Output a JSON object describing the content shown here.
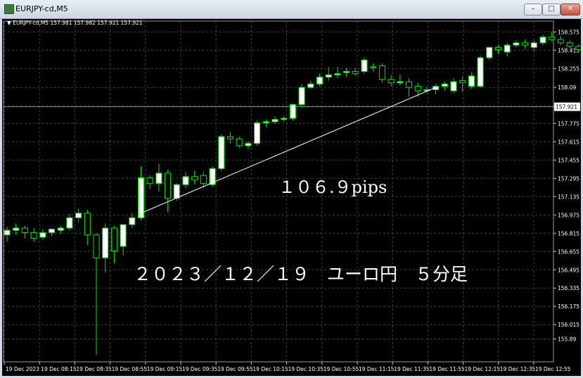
{
  "window": {
    "title": "EURJPY-cd,M5",
    "minimize_glyph": "–",
    "maximize_glyph": "□",
    "close_glyph": "✕"
  },
  "chart_data": {
    "type": "candlestick",
    "symbol_header": "EURJPY-cd,M5  157.981 157.982 157.921 157.921",
    "current_price_label": "157.921",
    "current_price": 157.921,
    "ylim": [
      155.69,
      158.67
    ],
    "grid": true,
    "yticks": [
      158.575,
      158.415,
      158.255,
      158.09,
      157.93,
      157.775,
      157.615,
      157.455,
      157.295,
      157.135,
      156.975,
      156.815,
      156.655,
      156.495,
      156.335,
      156.175,
      156.015,
      155.89
    ],
    "ytick_labels": [
      "158.575",
      "158.415",
      "158.255",
      "158.09",
      "157.93",
      "157.775",
      "157.615",
      "157.455",
      "157.295",
      "157.135",
      "156.975",
      "156.815",
      "156.655",
      "156.495",
      "156.335",
      "156.175",
      "156.015",
      "155.89"
    ],
    "xtick_labels": [
      "19 Dec 2023",
      "19 Dec 08:15",
      "19 Dec 08:35",
      "19 Dec 08:55",
      "19 Dec 09:15",
      "19 Dec 09:35",
      "19 Dec 09:55",
      "19 Dec 10:15",
      "19 Dec 10:35",
      "19 Dec 10:55",
      "19 Dec 11:15",
      "19 Dec 11:35",
      "19 Dec 11:55",
      "19 Dec 12:15",
      "19 Dec 12:35",
      "19 Dec 12:55"
    ],
    "candles": [
      {
        "o": 156.8,
        "h": 156.87,
        "l": 156.74,
        "c": 156.84
      },
      {
        "o": 156.84,
        "h": 156.9,
        "l": 156.8,
        "c": 156.86
      },
      {
        "o": 156.86,
        "h": 156.88,
        "l": 156.77,
        "c": 156.82
      },
      {
        "o": 156.82,
        "h": 156.86,
        "l": 156.74,
        "c": 156.77
      },
      {
        "o": 156.78,
        "h": 156.85,
        "l": 156.76,
        "c": 156.82
      },
      {
        "o": 156.82,
        "h": 156.86,
        "l": 156.79,
        "c": 156.85
      },
      {
        "o": 156.84,
        "h": 156.88,
        "l": 156.81,
        "c": 156.86
      },
      {
        "o": 156.86,
        "h": 156.98,
        "l": 156.84,
        "c": 156.95
      },
      {
        "o": 156.95,
        "h": 157.03,
        "l": 156.91,
        "c": 156.99
      },
      {
        "o": 156.99,
        "h": 157.02,
        "l": 156.71,
        "c": 156.8
      },
      {
        "o": 156.8,
        "h": 156.81,
        "l": 155.75,
        "c": 156.6
      },
      {
        "o": 156.6,
        "h": 156.9,
        "l": 156.47,
        "c": 156.86
      },
      {
        "o": 156.86,
        "h": 156.88,
        "l": 156.55,
        "c": 156.66
      },
      {
        "o": 156.7,
        "h": 156.88,
        "l": 156.62,
        "c": 156.89
      },
      {
        "o": 156.89,
        "h": 156.99,
        "l": 156.86,
        "c": 156.95
      },
      {
        "o": 156.95,
        "h": 157.4,
        "l": 156.93,
        "c": 157.3
      },
      {
        "o": 157.3,
        "h": 157.32,
        "l": 157.2,
        "c": 157.25
      },
      {
        "o": 157.25,
        "h": 157.42,
        "l": 157.18,
        "c": 157.34
      },
      {
        "o": 157.34,
        "h": 157.37,
        "l": 157.0,
        "c": 157.12
      },
      {
        "o": 157.12,
        "h": 157.25,
        "l": 157.1,
        "c": 157.24
      },
      {
        "o": 157.24,
        "h": 157.35,
        "l": 157.21,
        "c": 157.31
      },
      {
        "o": 157.31,
        "h": 157.36,
        "l": 157.24,
        "c": 157.28
      },
      {
        "o": 157.32,
        "h": 157.35,
        "l": 157.21,
        "c": 157.25
      },
      {
        "o": 157.24,
        "h": 157.4,
        "l": 157.22,
        "c": 157.38
      },
      {
        "o": 157.38,
        "h": 157.68,
        "l": 157.36,
        "c": 157.66
      },
      {
        "o": 157.66,
        "h": 157.7,
        "l": 157.6,
        "c": 157.64
      },
      {
        "o": 157.64,
        "h": 157.66,
        "l": 157.56,
        "c": 157.58
      },
      {
        "o": 157.58,
        "h": 157.62,
        "l": 157.55,
        "c": 157.6
      },
      {
        "o": 157.6,
        "h": 157.8,
        "l": 157.58,
        "c": 157.78
      },
      {
        "o": 157.78,
        "h": 157.81,
        "l": 157.74,
        "c": 157.79
      },
      {
        "o": 157.79,
        "h": 157.84,
        "l": 157.77,
        "c": 157.81
      },
      {
        "o": 157.81,
        "h": 157.84,
        "l": 157.79,
        "c": 157.82
      },
      {
        "o": 157.82,
        "h": 157.95,
        "l": 157.8,
        "c": 157.94
      },
      {
        "o": 157.94,
        "h": 158.12,
        "l": 157.91,
        "c": 158.09
      },
      {
        "o": 158.09,
        "h": 158.15,
        "l": 158.08,
        "c": 158.12
      },
      {
        "o": 158.12,
        "h": 158.21,
        "l": 158.1,
        "c": 158.18
      },
      {
        "o": 158.18,
        "h": 158.27,
        "l": 158.15,
        "c": 158.2
      },
      {
        "o": 158.2,
        "h": 158.27,
        "l": 158.17,
        "c": 158.21
      },
      {
        "o": 158.22,
        "h": 158.26,
        "l": 158.18,
        "c": 158.23
      },
      {
        "o": 158.23,
        "h": 158.26,
        "l": 158.19,
        "c": 158.21
      },
      {
        "o": 158.23,
        "h": 158.35,
        "l": 158.21,
        "c": 158.33
      },
      {
        "o": 158.27,
        "h": 158.3,
        "l": 158.23,
        "c": 158.27
      },
      {
        "o": 158.28,
        "h": 158.3,
        "l": 158.13,
        "c": 158.16
      },
      {
        "o": 158.16,
        "h": 158.2,
        "l": 158.1,
        "c": 158.13
      },
      {
        "o": 158.13,
        "h": 158.2,
        "l": 158.11,
        "c": 158.14
      },
      {
        "o": 158.14,
        "h": 158.17,
        "l": 158.01,
        "c": 158.09
      },
      {
        "o": 158.1,
        "h": 158.13,
        "l": 158.01,
        "c": 158.06
      },
      {
        "o": 158.06,
        "h": 158.09,
        "l": 158.04,
        "c": 158.07
      },
      {
        "o": 158.07,
        "h": 158.12,
        "l": 158.03,
        "c": 158.1
      },
      {
        "o": 158.1,
        "h": 158.14,
        "l": 158.06,
        "c": 158.12
      },
      {
        "o": 158.06,
        "h": 158.17,
        "l": 158.04,
        "c": 158.14
      },
      {
        "o": 158.15,
        "h": 158.18,
        "l": 158.05,
        "c": 158.13
      },
      {
        "o": 158.1,
        "h": 158.22,
        "l": 158.08,
        "c": 158.19
      },
      {
        "o": 158.1,
        "h": 158.37,
        "l": 158.09,
        "c": 158.35
      },
      {
        "o": 158.35,
        "h": 158.45,
        "l": 158.33,
        "c": 158.44
      },
      {
        "o": 158.44,
        "h": 158.46,
        "l": 158.38,
        "c": 158.42
      },
      {
        "o": 158.4,
        "h": 158.48,
        "l": 158.36,
        "c": 158.46
      },
      {
        "o": 158.46,
        "h": 158.5,
        "l": 158.44,
        "c": 158.48
      },
      {
        "o": 158.48,
        "h": 158.51,
        "l": 158.43,
        "c": 158.46
      },
      {
        "o": 158.44,
        "h": 158.5,
        "l": 158.41,
        "c": 158.48
      },
      {
        "o": 158.48,
        "h": 158.55,
        "l": 158.46,
        "c": 158.53
      },
      {
        "o": 158.53,
        "h": 158.58,
        "l": 158.49,
        "c": 158.51
      },
      {
        "o": 158.51,
        "h": 158.54,
        "l": 158.46,
        "c": 158.48
      },
      {
        "o": 158.48,
        "h": 158.5,
        "l": 158.43,
        "c": 158.45
      },
      {
        "o": 158.45,
        "h": 158.47,
        "l": 158.41,
        "c": 158.42
      }
    ],
    "trendline": {
      "from_index": 15,
      "from_price": 156.99,
      "to_index": 48,
      "to_price": 158.09
    },
    "annotation_pips": "１０６.９pips",
    "annotation_caption": "２０２３／１２／１９　ユーロ円　５分足",
    "colors": {
      "background": "#000000",
      "grid": "#33454f",
      "bull_body": "#ffffff",
      "bear_body": "#000000",
      "wick": "#00e400",
      "text": "#ffffff",
      "trendline": "#ffffff",
      "price_line": "#8a8a8a"
    }
  }
}
